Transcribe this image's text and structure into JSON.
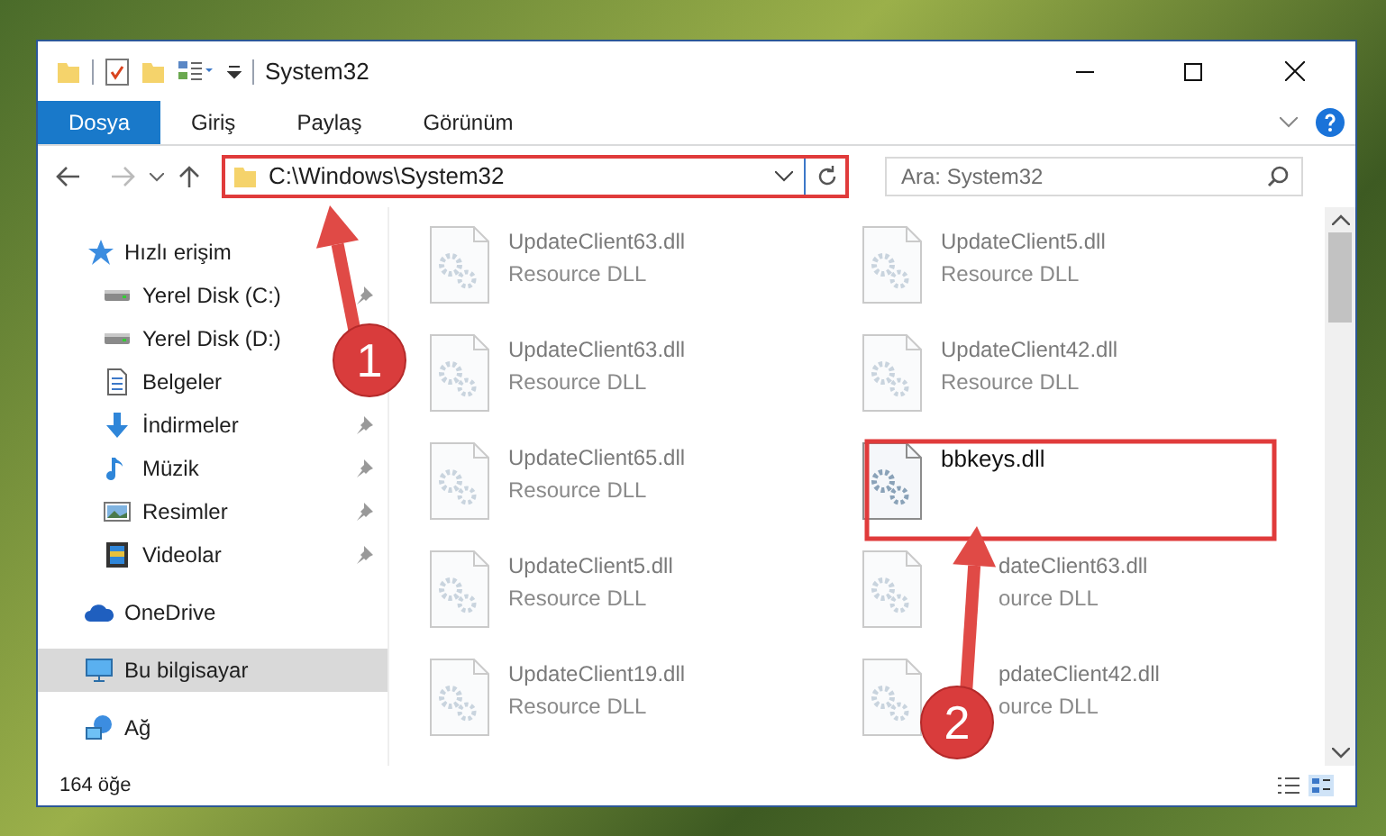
{
  "window": {
    "title": "System32"
  },
  "ribbon_tabs": [
    {
      "label": "Dosya",
      "selected": true
    },
    {
      "label": "Giriş",
      "selected": false
    },
    {
      "label": "Paylaş",
      "selected": false
    },
    {
      "label": "Görünüm",
      "selected": false
    }
  ],
  "address_bar": {
    "path": "C:\\Windows\\System32"
  },
  "search": {
    "placeholder": "Ara: System32"
  },
  "sidebar": [
    {
      "label": "Hızlı erişim",
      "kind": "star",
      "selected": false,
      "children": [
        {
          "label": "Yerel Disk (C:)",
          "kind": "drive",
          "pinned": true,
          "selected": false
        },
        {
          "label": "Yerel Disk (D:)",
          "kind": "drive",
          "pinned": false,
          "selected": false
        },
        {
          "label": "Belgeler",
          "kind": "document",
          "pinned": false,
          "selected": false
        },
        {
          "label": "İndirmeler",
          "kind": "download",
          "pinned": true,
          "selected": false
        },
        {
          "label": "Müzik",
          "kind": "music",
          "pinned": true,
          "selected": false
        },
        {
          "label": "Resimler",
          "kind": "picture",
          "pinned": true,
          "selected": false
        },
        {
          "label": "Videolar",
          "kind": "video",
          "pinned": true,
          "selected": false
        }
      ]
    },
    {
      "label": "OneDrive",
      "kind": "cloud",
      "selected": false
    },
    {
      "label": "Bu bilgisayar",
      "kind": "computer",
      "selected": true
    },
    {
      "label": "Ağ",
      "kind": "network",
      "selected": false
    }
  ],
  "files": [
    {
      "name": "UpdateClient63.dll",
      "type": "Resource DLL",
      "blurred": true
    },
    {
      "name": "UpdateClient5.dll",
      "type": "Resource DLL",
      "blurred": true
    },
    {
      "name": "UpdateClient63.dll",
      "type": "Resource DLL",
      "blurred": true
    },
    {
      "name": "UpdateClient42.dll",
      "type": "Resource DLL",
      "blurred": true
    },
    {
      "name": "UpdateClient65.dll",
      "type": "Resource DLL",
      "blurred": true
    },
    {
      "name": "bbkeys.dll",
      "blurred": false
    },
    {
      "name": "UpdateClient5.dll",
      "type": "Resource DLL",
      "blurred": true
    },
    {
      "name": "dateClient63.dll",
      "type": "ource DLL",
      "blurred": true,
      "covered": true
    },
    {
      "name": "UpdateClient19.dll",
      "type": "Resource DLL",
      "blurred": true
    },
    {
      "name": "pdateClient42.dll",
      "type": "ource DLL",
      "blurred": true,
      "covered": true
    }
  ],
  "status_bar": {
    "item_count": "164 öğe"
  },
  "annotations": [
    {
      "label": "1"
    },
    {
      "label": "2"
    }
  ]
}
